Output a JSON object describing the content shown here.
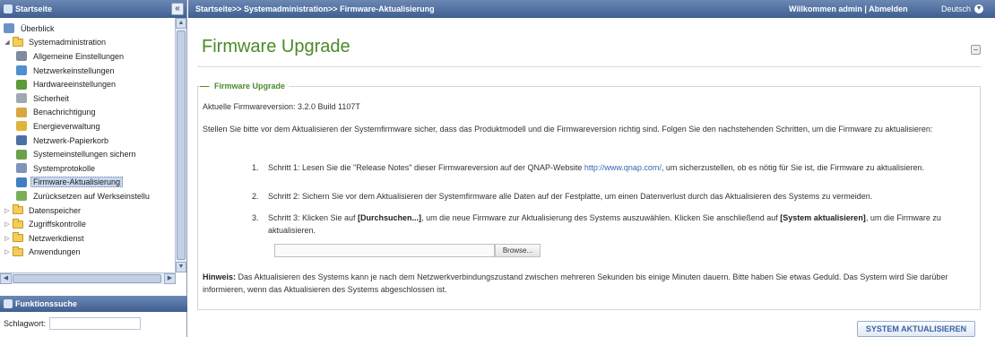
{
  "sidebar": {
    "header_title": "Startseite",
    "collapse_label": "«",
    "tree": [
      {
        "label": "Überblick",
        "level": 1,
        "icon": "overview-icon"
      },
      {
        "label": "Systemadministration",
        "level": 1,
        "icon": "folder-icon",
        "expanded": true
      },
      {
        "label": "Allgemeine Einstellungen",
        "level": 2,
        "icon": "general-settings-icon"
      },
      {
        "label": "Netzwerkeinstellungen",
        "level": 2,
        "icon": "network-icon"
      },
      {
        "label": "Hardwareeinstellungen",
        "level": 2,
        "icon": "hardware-icon"
      },
      {
        "label": "Sicherheit",
        "level": 2,
        "icon": "security-icon"
      },
      {
        "label": "Benachrichtigung",
        "level": 2,
        "icon": "notification-icon"
      },
      {
        "label": "Energieverwaltung",
        "level": 2,
        "icon": "power-icon"
      },
      {
        "label": "Netzwerk-Papierkorb",
        "level": 2,
        "icon": "recycle-bin-icon"
      },
      {
        "label": "Systemeinstellungen sichern",
        "level": 2,
        "icon": "backup-icon"
      },
      {
        "label": "Systemprotokolle",
        "level": 2,
        "icon": "logs-icon"
      },
      {
        "label": "Firmware-Aktualisierung",
        "level": 2,
        "icon": "firmware-icon",
        "selected": true
      },
      {
        "label": "Zurücksetzen auf Werkseinstellu",
        "level": 2,
        "icon": "reset-icon"
      },
      {
        "label": "Datenspeicher",
        "level": 1,
        "icon": "folder-icon"
      },
      {
        "label": "Zugriffskontrolle",
        "level": 1,
        "icon": "folder-icon"
      },
      {
        "label": "Netzwerkdienst",
        "level": 1,
        "icon": "folder-icon"
      },
      {
        "label": "Anwendungen",
        "level": 1,
        "icon": "folder-icon"
      }
    ],
    "search": {
      "header_title": "Funktionssuche",
      "label": "Schlagwort:",
      "value": ""
    }
  },
  "topbar": {
    "breadcrumb": "Startseite>> Systemadministration>> Firmware-Aktualisierung",
    "welcome_prefix": "Willkommen admin |",
    "logout": "Abmelden",
    "language": "Deutsch"
  },
  "main": {
    "title": "Firmware Upgrade",
    "legend": "Firmware Upgrade",
    "firmware_version": "Aktuelle Firmwareversion: 3.2.0 Build 1107T",
    "intro": "Stellen Sie bitte vor dem Aktualisieren der Systemfirmware sicher, dass das Produktmodell und die Firmwareversion richtig sind. Folgen Sie den nachstehenden Schritten, um die Firmware zu aktualisieren:",
    "step1": {
      "num": "1.",
      "pre": "Schritt 1: Lesen Sie die \"Release Notes\" dieser Firmwareversion auf der QNAP-Website ",
      "link": "http://www.qnap.com/",
      "post": ", um sicherzustellen, ob es nötig für Sie ist, die Firmware zu aktualisieren."
    },
    "step2": {
      "num": "2.",
      "text": "Schritt 2: Sichern Sie vor dem Aktualisieren der Systemfirmware alle Daten auf der Festplatte, um einen Datenverlust durch das Aktualisieren des Systems zu vermeiden."
    },
    "step3": {
      "num": "3.",
      "pre": "Schritt 3: Klicken Sie auf ",
      "bold1": "[Durchsuchen...]",
      "mid": ", um die neue Firmware zur Aktualisierung des Systems auszuwählen. Klicken Sie anschließend auf ",
      "bold2": "[System aktualisieren]",
      "post": ", um die Firmware zu aktualisieren."
    },
    "file_value": "",
    "browse_label": "Browse...",
    "hint_label": "Hinweis:",
    "hint_text": " Das Aktualisieren des Systems kann je nach dem Netzwerkverbindungszustand zwischen mehreren Sekunden bis einige Minuten dauern. Bitte haben Sie etwas Geduld. Das System wird Sie darüber informieren, wenn das Aktualisieren des Systems abgeschlossen ist.",
    "update_button": "SYSTEM AKTUALISIEREN"
  },
  "colors": {
    "accent_green": "#4b8a2a",
    "header_blue": "#3f5f91",
    "link_blue": "#3266b3"
  }
}
